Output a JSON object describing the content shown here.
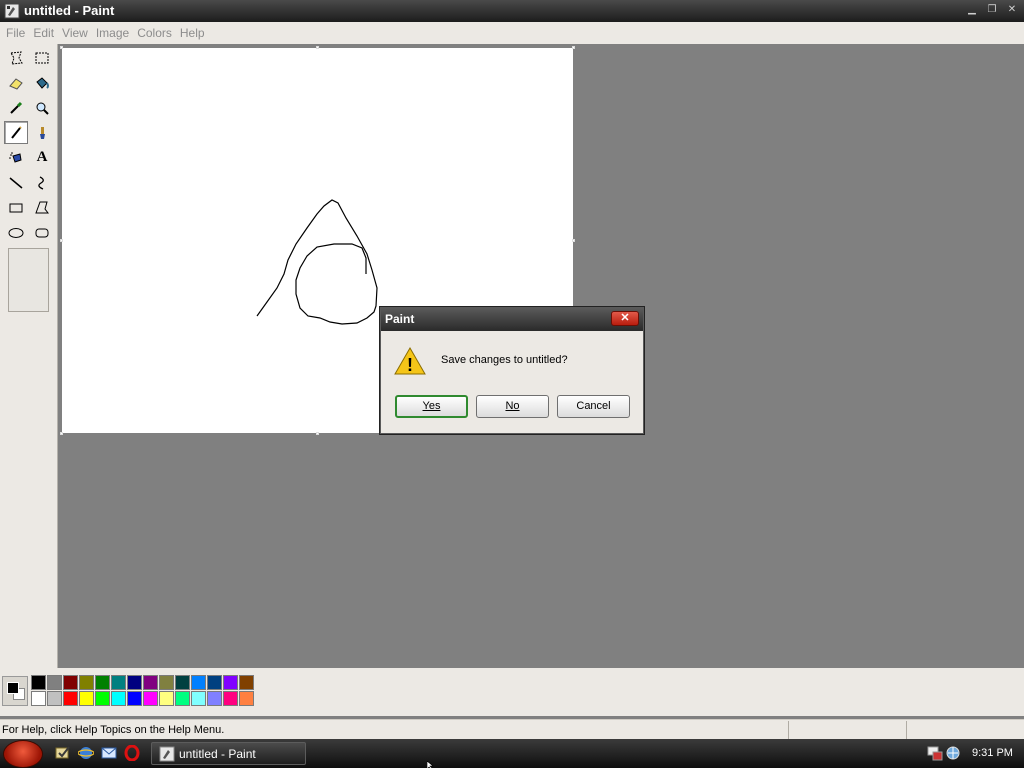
{
  "window": {
    "title": "untitled - Paint",
    "minimize_glyph": "▁",
    "maximize_glyph": "❐",
    "close_glyph": "✕"
  },
  "menu": [
    {
      "label": "File"
    },
    {
      "label": "Edit"
    },
    {
      "label": "View"
    },
    {
      "label": "Image"
    },
    {
      "label": "Colors"
    },
    {
      "label": "Help"
    }
  ],
  "toolbox": {
    "tools": [
      {
        "name": "free-form-select-icon"
      },
      {
        "name": "rect-select-icon"
      },
      {
        "name": "eraser-icon"
      },
      {
        "name": "fill-bucket-icon"
      },
      {
        "name": "color-picker-icon"
      },
      {
        "name": "magnifier-icon"
      },
      {
        "name": "pencil-icon",
        "active": true
      },
      {
        "name": "brush-icon"
      },
      {
        "name": "airbrush-icon"
      },
      {
        "name": "text-icon",
        "glyph": "A"
      },
      {
        "name": "line-icon"
      },
      {
        "name": "curve-icon"
      },
      {
        "name": "rectangle-icon"
      },
      {
        "name": "polygon-icon"
      },
      {
        "name": "ellipse-icon"
      },
      {
        "name": "rounded-rect-icon"
      }
    ]
  },
  "palette": {
    "foreground": "#000000",
    "background": "#ffffff",
    "row1": [
      "#000000",
      "#808080",
      "#800000",
      "#808000",
      "#008000",
      "#008080",
      "#000080",
      "#800080",
      "#808040",
      "#004040",
      "#0080ff",
      "#004080",
      "#8000ff",
      "#804000"
    ],
    "row2": [
      "#ffffff",
      "#c0c0c0",
      "#ff0000",
      "#ffff00",
      "#00ff00",
      "#00ffff",
      "#0000ff",
      "#ff00ff",
      "#ffff80",
      "#00ff80",
      "#80ffff",
      "#8080ff",
      "#ff0080",
      "#ff8040"
    ]
  },
  "status": {
    "help_text": "For Help, click Help Topics on the Help Menu."
  },
  "taskbar": {
    "task_label": "untitled - Paint",
    "clock": "9:31 PM"
  },
  "dialog": {
    "title": "Paint",
    "close_glyph": "✕",
    "message": "Save changes to untitled?",
    "yes_label": "Yes",
    "no_label": "No",
    "cancel_label": "Cancel",
    "warning_glyph": "!"
  }
}
